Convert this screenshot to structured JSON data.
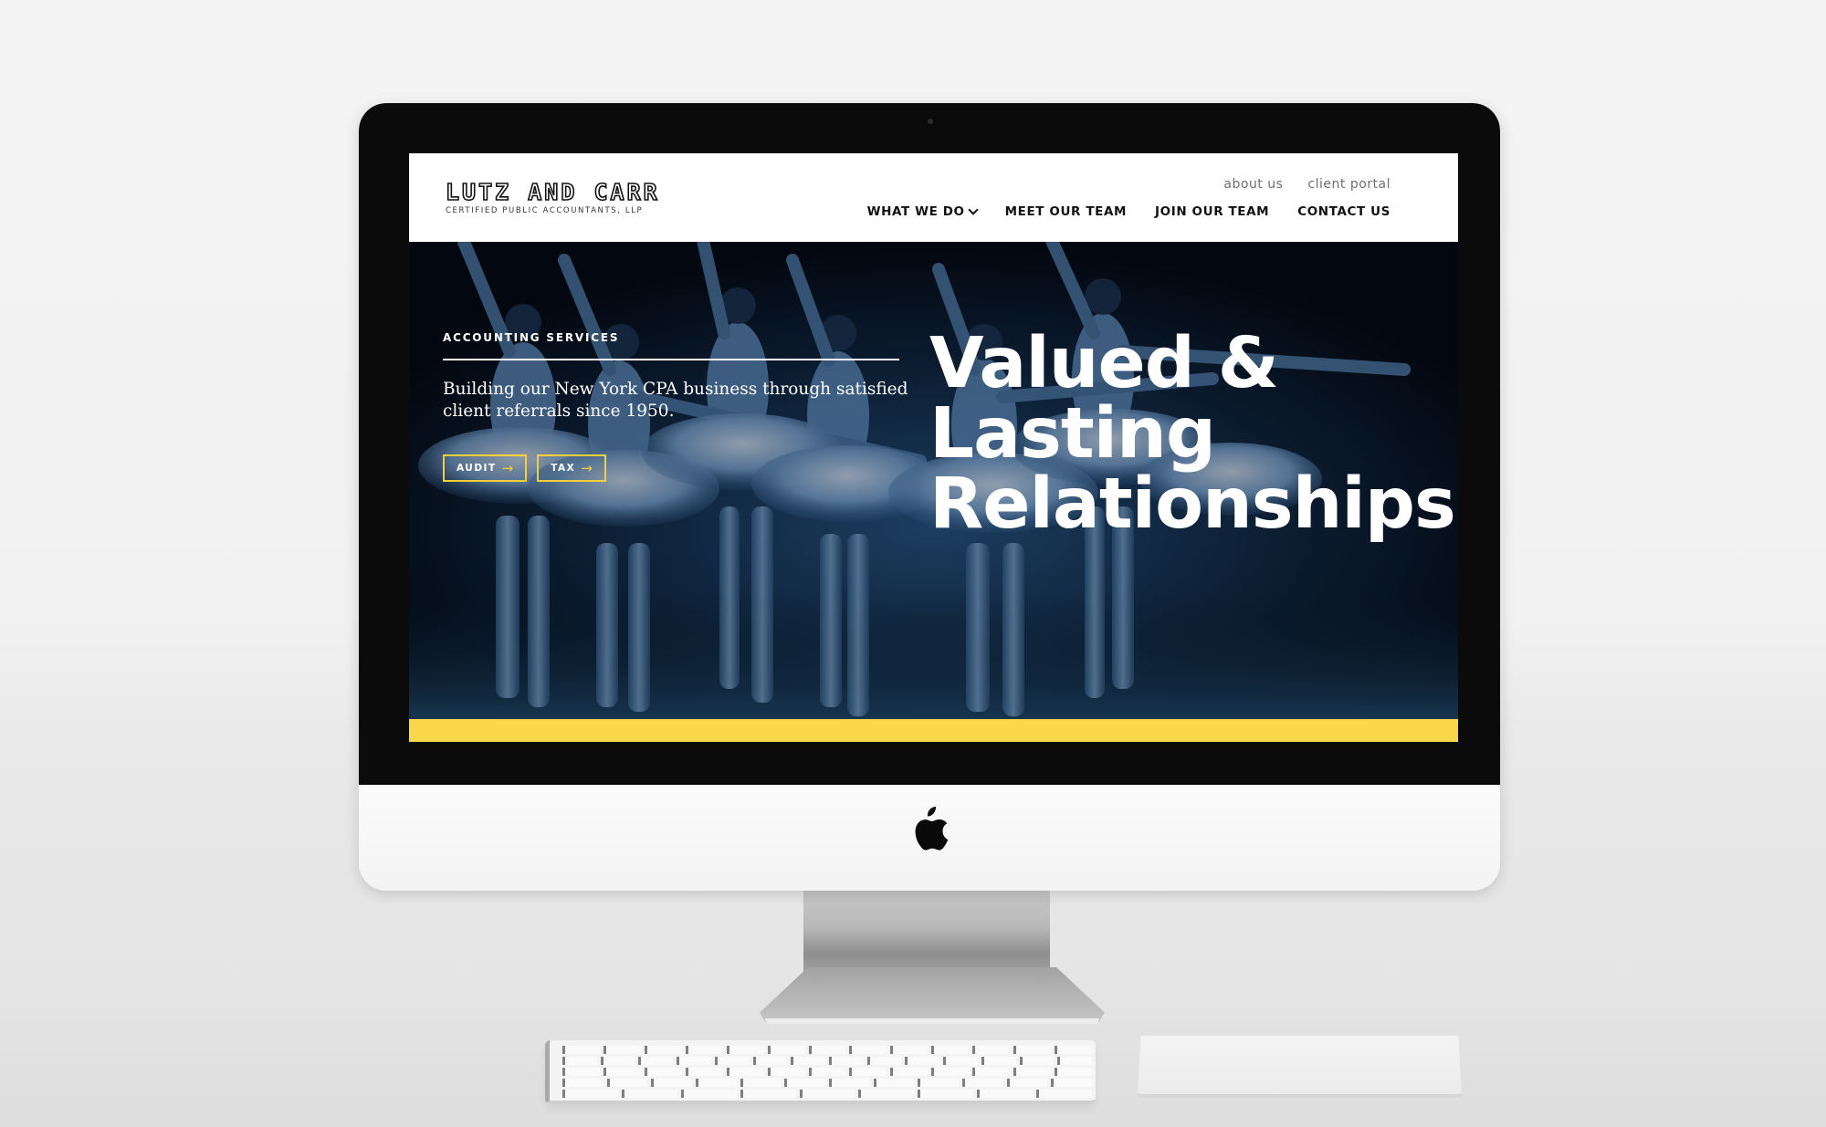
{
  "site": {
    "logo": {
      "name": "LUTZ AND CARR",
      "tagline": "CERTIFIED PUBLIC ACCOUNTANTS, LLP"
    },
    "utility_nav": [
      {
        "label": "about us"
      },
      {
        "label": "client portal"
      }
    ],
    "main_nav": [
      {
        "label": "WHAT WE DO",
        "icon": "chevron-down-icon"
      },
      {
        "label": "MEET OUR TEAM"
      },
      {
        "label": "JOIN OUR TEAM"
      },
      {
        "label": "CONTACT US"
      }
    ],
    "hero": {
      "eyebrow": "ACCOUNTING SERVICES",
      "lead": "Building our New York CPA business through satisfied client referrals since 1950.",
      "buttons": [
        {
          "label": "AUDIT",
          "icon": "arrow-right-icon",
          "arrow": "→"
        },
        {
          "label": "TAX",
          "icon": "arrow-right-icon",
          "arrow": "→"
        }
      ],
      "headline_lines": [
        "Valued &",
        "Lasting",
        "Relationships"
      ],
      "background": "ballet dancers in white tutus on dark stage"
    },
    "colors": {
      "accent_yellow": "#fad84a",
      "button_border": "#f5cf38",
      "hero_dark": "#050a14",
      "nav_text": "#111111",
      "utility_text": "#6e6e6e"
    }
  },
  "device": {
    "type": "desktop monitor mockup",
    "logo_icon": "apple-logo-icon"
  }
}
